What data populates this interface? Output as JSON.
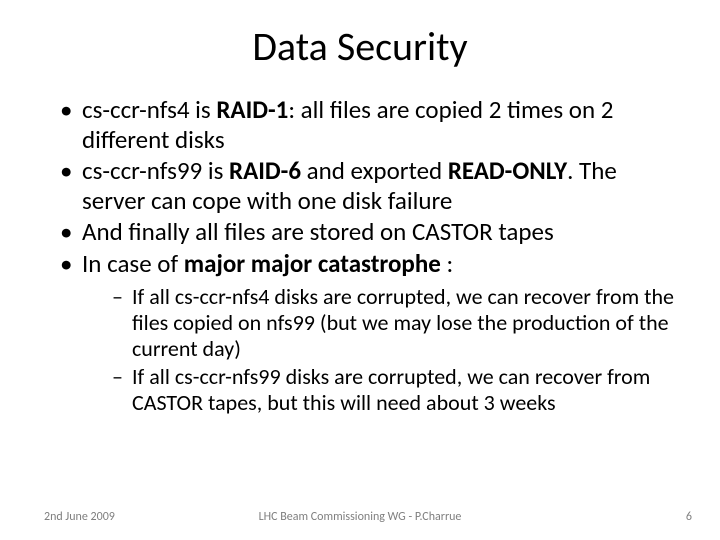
{
  "title": "Data Security",
  "bullets": {
    "b1a": "cs-ccr-nfs4 is ",
    "b1b": "RAID-1",
    "b1c": ": all files are copied 2 times on 2 different disks",
    "b2a": "cs-ccr-nfs99 is ",
    "b2b": "RAID-6",
    "b2c": " and exported ",
    "b2d": "READ-ONLY",
    "b2e": ". The server can cope with one disk failure",
    "b3": "And finally all files are stored on CASTOR tapes",
    "b4a": "In case of ",
    "b4b": "major major catastrophe",
    "b4c": " :",
    "s1": "If all cs-ccr-nfs4 disks are corrupted, we can recover from the files copied on nfs99 (but we may lose the production of the current day)",
    "s2": "If all cs-ccr-nfs99 disks are corrupted, we can recover from CASTOR tapes, but this will need about 3 weeks"
  },
  "footer": {
    "date": "2nd June 2009",
    "center": "LHC Beam Commissioning WG - P.Charrue",
    "page": "6"
  }
}
